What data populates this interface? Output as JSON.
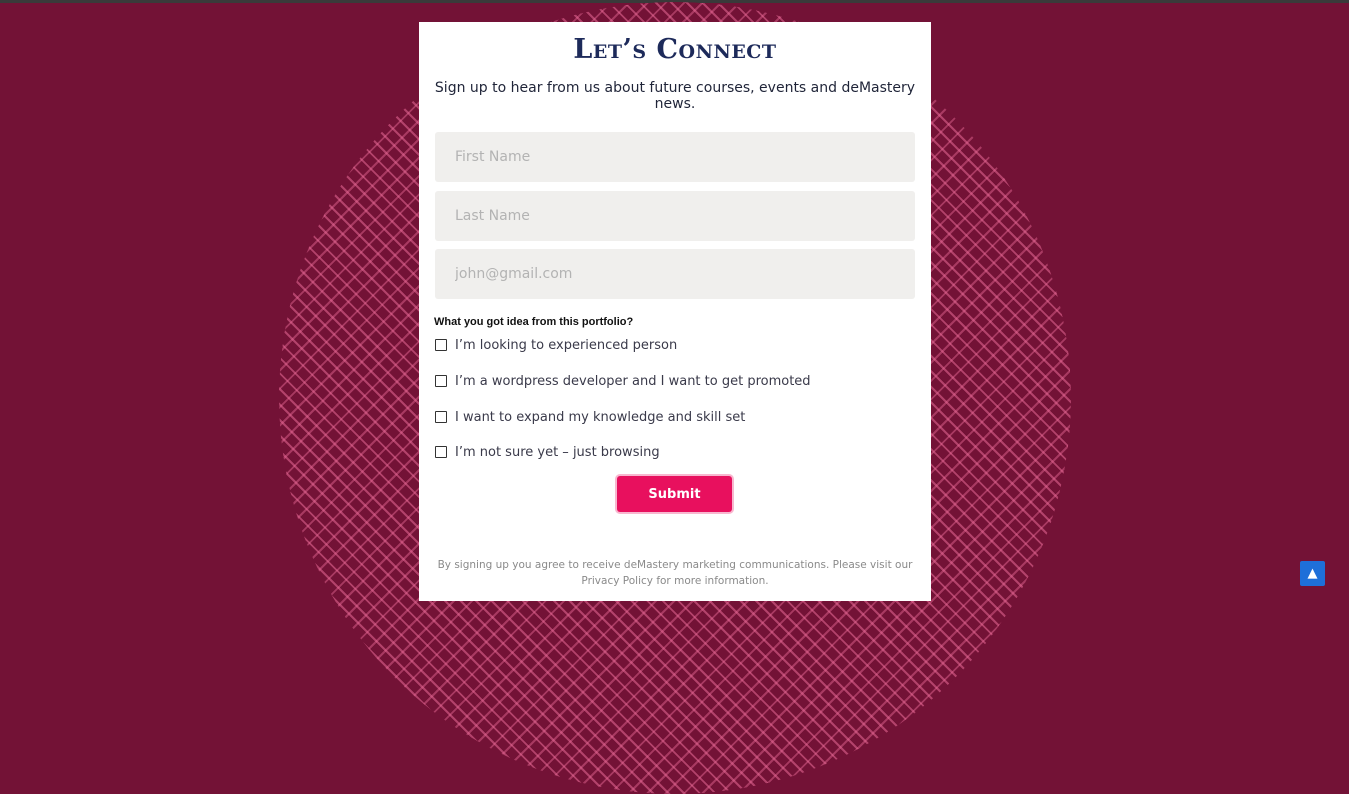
{
  "form": {
    "title": "Let’s Connect",
    "subtitle": "Sign up to hear from us about future courses, events and deMastery news.",
    "fields": {
      "first_name_placeholder": "First Name",
      "last_name_placeholder": "Last Name",
      "email_placeholder": "john@gmail.com"
    },
    "question": "What you got idea from this portfolio?",
    "options": [
      "I’m looking to experienced person",
      "I’m a wordpress developer and I want to get promoted",
      "I want to expand my knowledge and skill set",
      "I’m not sure yet – just browsing"
    ],
    "submit_label": "Submit",
    "disclaimer_line1": "By signing up you agree to receive deMastery marketing communications. Please visit our",
    "disclaimer_line2": "Privacy Policy for more information."
  },
  "scroll_top": {
    "icon": "chevron-up-icon",
    "glyph": "▲"
  },
  "colors": {
    "background": "#731236",
    "title": "#1d2a5a",
    "submit": "#e8105e",
    "scroll_top": "#1e6fd9"
  }
}
